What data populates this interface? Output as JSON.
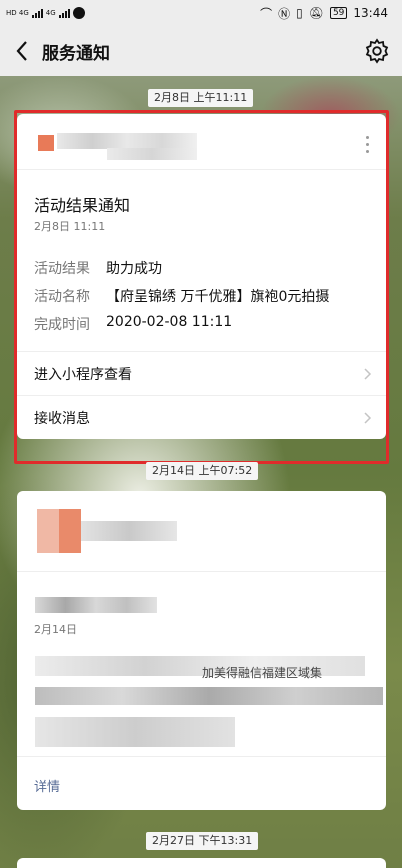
{
  "status_bar": {
    "net1": "HD 4G",
    "net2": "4G",
    "battery": "59",
    "time": "13:44"
  },
  "nav": {
    "title": "服务通知",
    "back_icon": "chevron-left-icon",
    "settings_icon": "gear-icon"
  },
  "stamps": {
    "s1": "2月8日 上午11:11",
    "s2": "2月14日 上午07:52",
    "s3": "2月27日 下午13:31"
  },
  "card1": {
    "title": "活动结果通知",
    "date": "2月8日  11:11",
    "fields": [
      {
        "label": "活动结果",
        "value": "助力成功"
      },
      {
        "label": "活动名称",
        "value": "【府呈锦绣 万千优雅】旗袍0元拍摄"
      },
      {
        "label": "完成时间",
        "value": "2020-02-08 11:11"
      }
    ],
    "actions": [
      {
        "label": "进入小程序查看"
      },
      {
        "label": "接收消息"
      }
    ]
  },
  "card2": {
    "date": "2月14日",
    "partial_text": "加美得融信福建区域集",
    "detail_label": "详情"
  },
  "colors": {
    "highlight_frame": "#e02b2b",
    "link": "#576b95"
  }
}
